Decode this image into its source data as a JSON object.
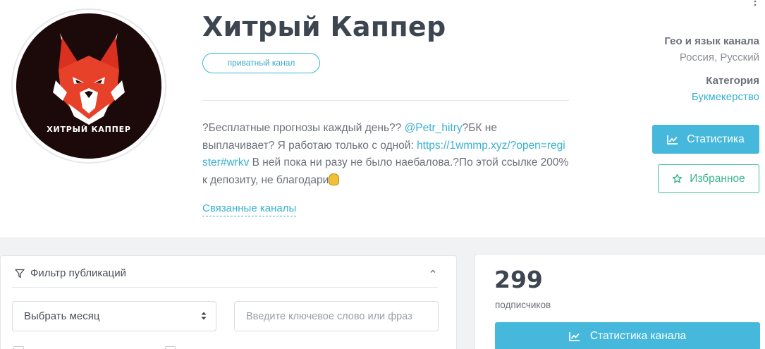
{
  "channel": {
    "title": "Хитрый Каппер",
    "badge": "приватный канал",
    "avatar_brand": "ХИТРЫЙ КАППЕР",
    "description": {
      "part1": "?Бесплатные прогнозы каждый день?? ",
      "mention": "@Petr_hitry",
      "part2": "?БК не выплачивает? Я работаю только с одной: ",
      "link": "https://1wmmp.xyz/?open=register#wrkv",
      "part3": " В ней пока ни разу не было наебалова.?По этой ссылке 200% к депозиту, не благодари"
    },
    "related_link": "Связанные каналы"
  },
  "meta": {
    "geo_label": "Гео и язык канала",
    "geo_value": "Россия, Русский",
    "category_label": "Категория",
    "category_value": "Букмекерство"
  },
  "actions": {
    "stats_label": "Статистика",
    "favorite_label": "Избранное"
  },
  "filter": {
    "title": "Фильтр публикаций",
    "month_select": "Выбрать месяц",
    "search_placeholder": "Введите ключевое слово или фраз"
  },
  "subscribers": {
    "count": "299",
    "label": "подписчиков",
    "stats_button": "Статистика канала"
  },
  "colors": {
    "accent": "#45b8dc",
    "link": "#38b0cf",
    "favorite": "#36b58d",
    "title": "#3d4550"
  },
  "icons": {
    "stats": "chart-line-icon",
    "favorite": "star-outline-icon",
    "filter": "funnel-icon",
    "collapse": "chevron-up-icon",
    "select": "sort-arrows-icon",
    "menu": "vertical-dots-icon"
  }
}
